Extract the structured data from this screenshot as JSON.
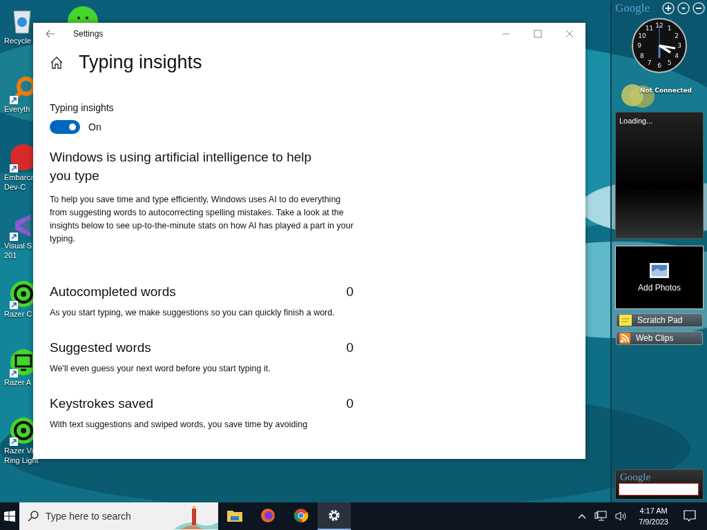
{
  "desktop_icons": [
    {
      "kind": "recycle",
      "lines": [
        "Recycle"
      ]
    },
    {
      "kind": "magnifier",
      "lines": [
        "Everyth"
      ]
    },
    {
      "kind": "devcpp",
      "lines": [
        "Embarca",
        "Dev-C"
      ]
    },
    {
      "kind": "studio",
      "lines": [
        "Visual S",
        "201"
      ]
    },
    {
      "kind": "ring",
      "lines": [
        "Razer C"
      ]
    },
    {
      "kind": "monitor",
      "lines": [
        "Razer A"
      ]
    },
    {
      "kind": "ring",
      "lines": [
        "Razer Vi",
        "Ring Light"
      ]
    }
  ],
  "window": {
    "title": "Settings",
    "page_title": "Typing insights",
    "toggle": {
      "label": "Typing insights",
      "on": true,
      "state_text": "On"
    },
    "heading": "Windows is using artificial intelligence to help you type",
    "intro": "To help you save time and type efficiently, Windows uses AI to do everything from suggesting words to autocorrecting spelling mistakes. Take a look at the insights below to see up-to-the-minute stats on how AI has played a part in your typing.",
    "stats": [
      {
        "title": "Autocompleted words",
        "value": "0",
        "description": "As you start typing, we make suggestions so you can quickly finish a word."
      },
      {
        "title": "Suggested words",
        "value": "0",
        "description": "We'll even guess your next word before you start typing it."
      },
      {
        "title": "Keystrokes saved",
        "value": "0",
        "description": "With text suggestions and swiped words, you save time by avoiding"
      }
    ]
  },
  "sidebar": {
    "logo": "Google",
    "clock_numbers": [
      "12",
      "11",
      "1",
      "10",
      "2",
      "9",
      "3",
      "8",
      "4",
      "7",
      "5",
      "6"
    ],
    "weather_status": "Not Connected",
    "feed_status": "Loading...",
    "photos_label": "Add Photos",
    "gadgets": [
      {
        "kind": "note",
        "label": "Scratch Pad"
      },
      {
        "kind": "rss",
        "label": "Web Clips"
      }
    ],
    "search": {
      "logo": "Google"
    }
  },
  "taskbar": {
    "search_placeholder": "Type here to search",
    "apps": [
      {
        "kind": "folder",
        "selected": false
      },
      {
        "kind": "firefox",
        "selected": false
      },
      {
        "kind": "chrome",
        "selected": false
      },
      {
        "kind": "gear",
        "selected": true
      }
    ],
    "time": "4:17 AM",
    "date": "7/9/2023"
  }
}
